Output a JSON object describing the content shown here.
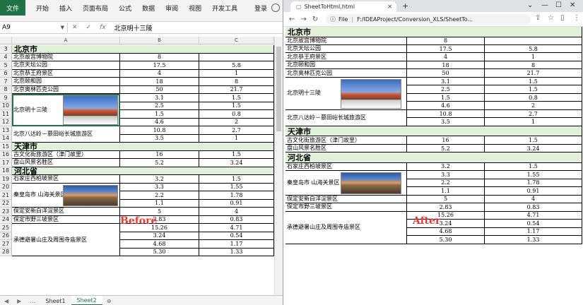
{
  "excel": {
    "ribbon": {
      "file_label": "文件",
      "tabs": [
        "开始",
        "插入",
        "页面布局",
        "公式",
        "数据",
        "审阅",
        "视图",
        "开发工具"
      ],
      "login": "登录"
    },
    "formula_bar": {
      "name_box": "A9",
      "cancel_icon": "✕",
      "enter_icon": "✓",
      "fx_label": "fx",
      "value": "北京明十三陵"
    },
    "columns": [
      "A",
      "B",
      "C"
    ],
    "sheet_tabs": [
      "Sheet1",
      "Sheet2"
    ],
    "active_sheet": "Sheet2",
    "before_label": "Before"
  },
  "browser": {
    "tab_title": "SheetToHtml.html",
    "url_scheme_label": "File",
    "url": "F:/IDEAProject/Conversion_XLS/SheetTo...",
    "after_label": "After"
  },
  "sheet": {
    "sections": [
      {
        "title": "北京市",
        "places": [
          {
            "name": "北京故宫博物院",
            "rows": [
              [
                "8",
                ""
              ]
            ]
          },
          {
            "name": "北京天坛公园",
            "rows": [
              [
                "17.5",
                "5.8"
              ]
            ]
          },
          {
            "name": "北京恭王府景区",
            "rows": [
              [
                "4",
                "1"
              ]
            ]
          },
          {
            "name": "北京颐和园",
            "rows": [
              [
                "18",
                "8"
              ]
            ]
          },
          {
            "name": "北京奥林匹克公园",
            "rows": [
              [
                "50",
                "21.7"
              ]
            ]
          },
          {
            "name": "北京明十三陵",
            "rows": [
              [
                "3.1",
                "1.5"
              ],
              [
                "2.5",
                "1.5"
              ],
              [
                "1.5",
                "0.8"
              ],
              [
                "4.6",
                "2"
              ]
            ],
            "image": "palace"
          },
          {
            "name": "北京八达岭－慕田峪长城旅游区",
            "rows": [
              [
                "10.8",
                "2.7"
              ],
              [
                "3.5",
                "1"
              ]
            ]
          }
        ]
      },
      {
        "title": "天津市",
        "places": [
          {
            "name": "古文化街旅游区（津门故里）",
            "rows": [
              [
                "16",
                "1.5"
              ]
            ]
          },
          {
            "name": "盘山风景名胜区",
            "rows": [
              [
                "5.2",
                "3.24"
              ]
            ]
          }
        ]
      },
      {
        "title": "河北省",
        "places": [
          {
            "name": "石家庄西柏坡景区",
            "rows": [
              [
                "3.2",
                "1.5"
              ]
            ]
          },
          {
            "name": "秦皇岛市 山海关景区",
            "rows": [
              [
                "3.3",
                "1.55"
              ],
              [
                "2.2",
                "1.78"
              ],
              [
                "1.1",
                "0.91"
              ]
            ],
            "image": "wall"
          },
          {
            "name": "保定安新白洋淀景区",
            "rows": [
              [
                "5",
                "4"
              ]
            ]
          },
          {
            "name": "保定市野三坡景区",
            "rows": [
              [
                "2.83",
                "0.83"
              ]
            ]
          },
          {
            "name": "承德避暑山庄及周围寺庙景区",
            "rows": [
              [
                "15.26",
                "4.71"
              ],
              [
                "3.24",
                "0.54"
              ],
              [
                "4.68",
                "1.17"
              ],
              [
                "5.30",
                "1.33"
              ]
            ]
          }
        ]
      }
    ]
  }
}
